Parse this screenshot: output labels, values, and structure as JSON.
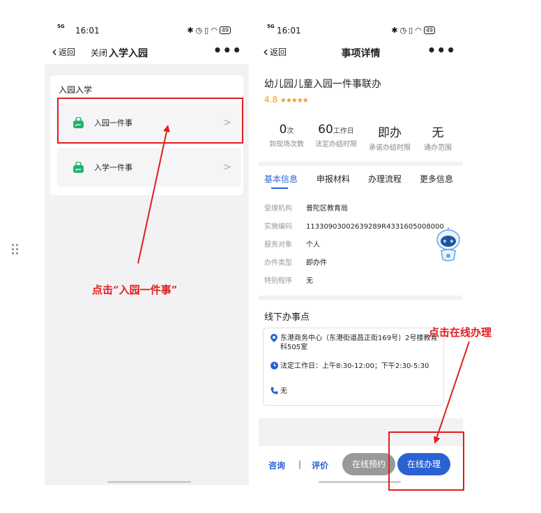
{
  "left": {
    "status": {
      "signal": "5G",
      "time": "16:01",
      "battery": "49"
    },
    "nav": {
      "back": "返回",
      "close": "关闭",
      "title": "入学入园",
      "more": "•••"
    },
    "card_title": "入园入学",
    "items": [
      {
        "label": "入园一件事",
        "arrow": ">"
      },
      {
        "label": "入学一件事",
        "arrow": ">"
      }
    ],
    "instruction": "点击“入园一件事”"
  },
  "right": {
    "status": {
      "signal": "5G",
      "time": "16:01",
      "battery": "49"
    },
    "nav": {
      "back": "返回",
      "title": "事项详情",
      "more": "•••"
    },
    "service_title": "幼儿园儿童入园一件事联办",
    "rating": "4.8",
    "rating_stars": 5,
    "stats": [
      {
        "value": "0",
        "unit": "次",
        "label": "到现场次数"
      },
      {
        "value": "60",
        "unit": "工作日",
        "label": "法定办结时限"
      },
      {
        "value": "即办",
        "unit": "",
        "label": "承诺办结时限"
      },
      {
        "value": "无",
        "unit": "",
        "label": "通办范围"
      }
    ],
    "tabs": [
      "基本信息",
      "申报材料",
      "办理流程",
      "更多信息"
    ],
    "info": [
      {
        "key": "受理机构",
        "value": "普陀区教育局"
      },
      {
        "key": "实施编码",
        "value": "11330903002639289R4331605008000"
      },
      {
        "key": "服务对象",
        "value": "个人"
      },
      {
        "key": "办件类型",
        "value": "即办件"
      },
      {
        "key": "特别程序",
        "value": "无"
      }
    ],
    "offline_title": "线下办事点",
    "office": {
      "address": "东港商务中心（东港街道昌正街169号）2号楼教育科505室",
      "hours": "法定工作日：上午8:30-12:00；下午2:30-5:30",
      "phone": "无"
    },
    "bottom": {
      "consult": "咨询",
      "sep": "|",
      "review": "评价",
      "reserve": "在线预约",
      "online": "在线办理"
    },
    "instruction": "点击在线办理"
  },
  "colors": {
    "accent": "#2a62d4",
    "highlight": "#e21c1c",
    "icon_green": "#1fb36d",
    "star": "#f09a1a"
  }
}
